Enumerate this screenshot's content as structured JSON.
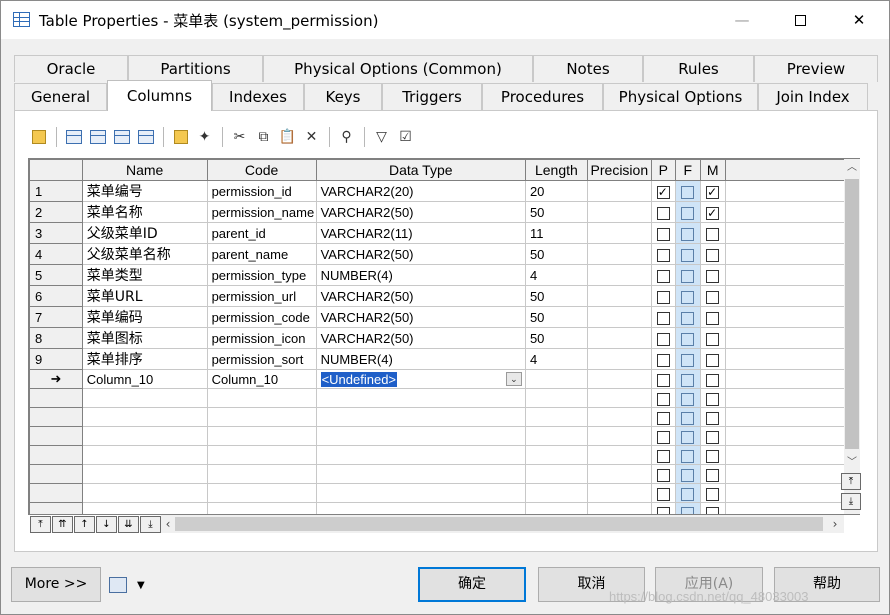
{
  "window": {
    "title": "Table Properties - 菜单表 (system_permission)"
  },
  "tabs": {
    "row1": [
      "Oracle",
      "Partitions",
      "Physical Options (Common)",
      "Notes",
      "Rules",
      "Preview"
    ],
    "row2": [
      "General",
      "Columns",
      "Indexes",
      "Keys",
      "Triggers",
      "Procedures",
      "Physical Options",
      "Join Index"
    ],
    "active": "Columns"
  },
  "grid": {
    "headers": [
      "Name",
      "Code",
      "Data Type",
      "Length",
      "Precision",
      "P",
      "F",
      "M"
    ],
    "rows": [
      {
        "num": "1",
        "name": "菜单编号",
        "code": "permission_id",
        "type": "VARCHAR2(20)",
        "length": "20",
        "precision": "",
        "p": true,
        "f": false,
        "m": true
      },
      {
        "num": "2",
        "name": "菜单名称",
        "code": "permission_name",
        "type": "VARCHAR2(50)",
        "length": "50",
        "precision": "",
        "p": false,
        "f": false,
        "m": true
      },
      {
        "num": "3",
        "name": "父级菜单ID",
        "code": "parent_id",
        "type": "VARCHAR2(11)",
        "length": "11",
        "precision": "",
        "p": false,
        "f": false,
        "m": false
      },
      {
        "num": "4",
        "name": "父级菜单名称",
        "code": "parent_name",
        "type": "VARCHAR2(50)",
        "length": "50",
        "precision": "",
        "p": false,
        "f": false,
        "m": false
      },
      {
        "num": "5",
        "name": "菜单类型",
        "code": "permission_type",
        "type": "NUMBER(4)",
        "length": "4",
        "precision": "",
        "p": false,
        "f": false,
        "m": false
      },
      {
        "num": "6",
        "name": "菜单URL",
        "code": "permission_url",
        "type": "VARCHAR2(50)",
        "length": "50",
        "precision": "",
        "p": false,
        "f": false,
        "m": false
      },
      {
        "num": "7",
        "name": "菜单编码",
        "code": "permission_code",
        "type": "VARCHAR2(50)",
        "length": "50",
        "precision": "",
        "p": false,
        "f": false,
        "m": false
      },
      {
        "num": "8",
        "name": "菜单图标",
        "code": "permission_icon",
        "type": "VARCHAR2(50)",
        "length": "50",
        "precision": "",
        "p": false,
        "f": false,
        "m": false
      },
      {
        "num": "9",
        "name": "菜单排序",
        "code": "permission_sort",
        "type": "NUMBER(4)",
        "length": "4",
        "precision": "",
        "p": false,
        "f": false,
        "m": false
      }
    ],
    "edit_row": {
      "marker": "➜",
      "name": "Column_10",
      "code": "Column_10",
      "type": "<Undefined>"
    },
    "empty_rows": 8
  },
  "buttons": {
    "more": "More >>",
    "ok": "确定",
    "cancel": "取消",
    "apply": "应用(A)",
    "help": "帮助"
  },
  "watermark": "https://blog.csdn.net/qq_48033003",
  "colors": {
    "accent": "#0078d7",
    "selection": "#1f5fc8",
    "fkey_column": "#cfe4f7"
  }
}
